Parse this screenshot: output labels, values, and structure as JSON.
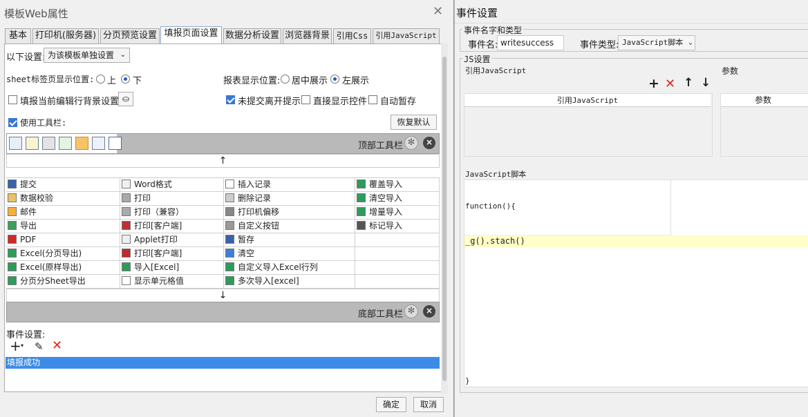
{
  "left": {
    "title": "模板Web属性",
    "tabs": [
      "基本",
      "打印机(服务器)",
      "分页预览设置",
      "填报页面设置",
      "数据分析设置",
      "浏览器背景",
      "引用Css",
      "引用JavaScript"
    ],
    "settings_label": "以下设置:",
    "settings_value": "为该模板单独设置",
    "sheet_pos_label": "sheet标签页显示位置:",
    "sheet_pos_up": "上",
    "sheet_pos_down": "下",
    "report_pos_label": "报表显示位置:",
    "report_pos_center": "居中展示",
    "report_pos_left": "左展示",
    "bg_setting_label": "填报当前编辑行背景设置:",
    "unsubmitted_label": "未提交离开提示",
    "direct_show_label": "直接显示控件",
    "autosave_label": "自动暂存",
    "use_toolbar_label": "使用工具栏:",
    "restore_default": "恢复默认",
    "top_toolbar": "顶部工具栏",
    "bottom_toolbar": "底部工具栏",
    "arrow_down": "↓",
    "arrow_up": "↑",
    "grid": [
      [
        "提交",
        "Word格式",
        "插入记录",
        "覆盖导入"
      ],
      [
        "数据校验",
        "打印",
        "删除记录",
        "清空导入"
      ],
      [
        "邮件",
        "打印（兼容）",
        "打印机偏移",
        "增量导入"
      ],
      [
        "导出",
        "打印[客户端]",
        "自定义按钮",
        "标记导入"
      ],
      [
        "PDF",
        "Applet打印",
        "暂存",
        ""
      ],
      [
        "Excel(分页导出)",
        "打印[客户端]",
        "清空",
        ""
      ],
      [
        "Excel(原样导出)",
        "导入[Excel]",
        "自定义导入Excel行列",
        ""
      ],
      [
        "分页分Sheet导出",
        "显示单元格值",
        "多次导入[excel]",
        ""
      ]
    ],
    "event_label": "事件设置:",
    "event_item": "填报成功",
    "ok": "确定",
    "cancel": "取消"
  },
  "right": {
    "title": "事件设置",
    "name_type_group": "事件名字和类型",
    "event_name_label": "事件名:",
    "event_name_value": "writesuccess",
    "event_type_label": "事件类型:",
    "event_type_value": "JavaScript脚本",
    "js_group": "JS设置",
    "ref_js_label": "引用JavaScript",
    "params_label": "参数",
    "ref_js_header": "引用JavaScript",
    "params_header": "参数",
    "script_label": "JavaScript脚本",
    "code_line1": "function(){",
    "code_line2": "_g().stach()",
    "code_line3": "}"
  },
  "colors": {
    "accent": "#3878d4",
    "selection": "#3c8ce7",
    "highlight": "#ffffc8",
    "delete": "#e02020"
  }
}
